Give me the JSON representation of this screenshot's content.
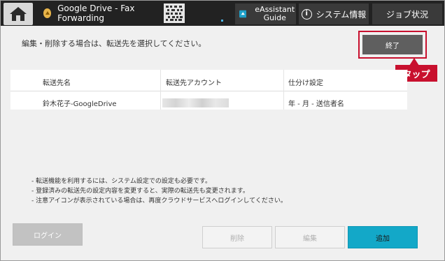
{
  "header": {
    "home_icon": "home-icon",
    "app_name": "Google Drive - Fax Forwarding",
    "app_icon": "google-drive-icon",
    "qr_icon": "qr-code-icon",
    "eassistant_label": "eAssistant Guide",
    "system_info_label": "システム情報",
    "job_status_label": "ジョブ状況"
  },
  "main": {
    "instruction": "編集・削除する場合は、転送先を選択してください。",
    "end_button": "終了",
    "tap_callout": "タップ",
    "table": {
      "columns": [
        "転送先名",
        "転送先アカウント",
        "仕分け設定"
      ],
      "rows": [
        {
          "name": "鈴木花子-GoogleDrive",
          "account": "",
          "sort_setting": "年 - 月 - 送信者名"
        }
      ]
    },
    "notes": [
      "- 転送機能を利用するには、システム設定での設定も必要です。",
      "- 登録済みの転送先の設定内容を変更すると、実際の転送先も変更されます。",
      "- 注意アイコンが表示されている場合は、再度クラウドサービスへログインしてください。"
    ],
    "buttons": {
      "login": "ログイン",
      "delete": "削除",
      "edit": "編集",
      "add": "追加"
    }
  },
  "colors": {
    "accent": "#13a8c8",
    "callout": "#c8102e",
    "topbar": "#222222"
  }
}
